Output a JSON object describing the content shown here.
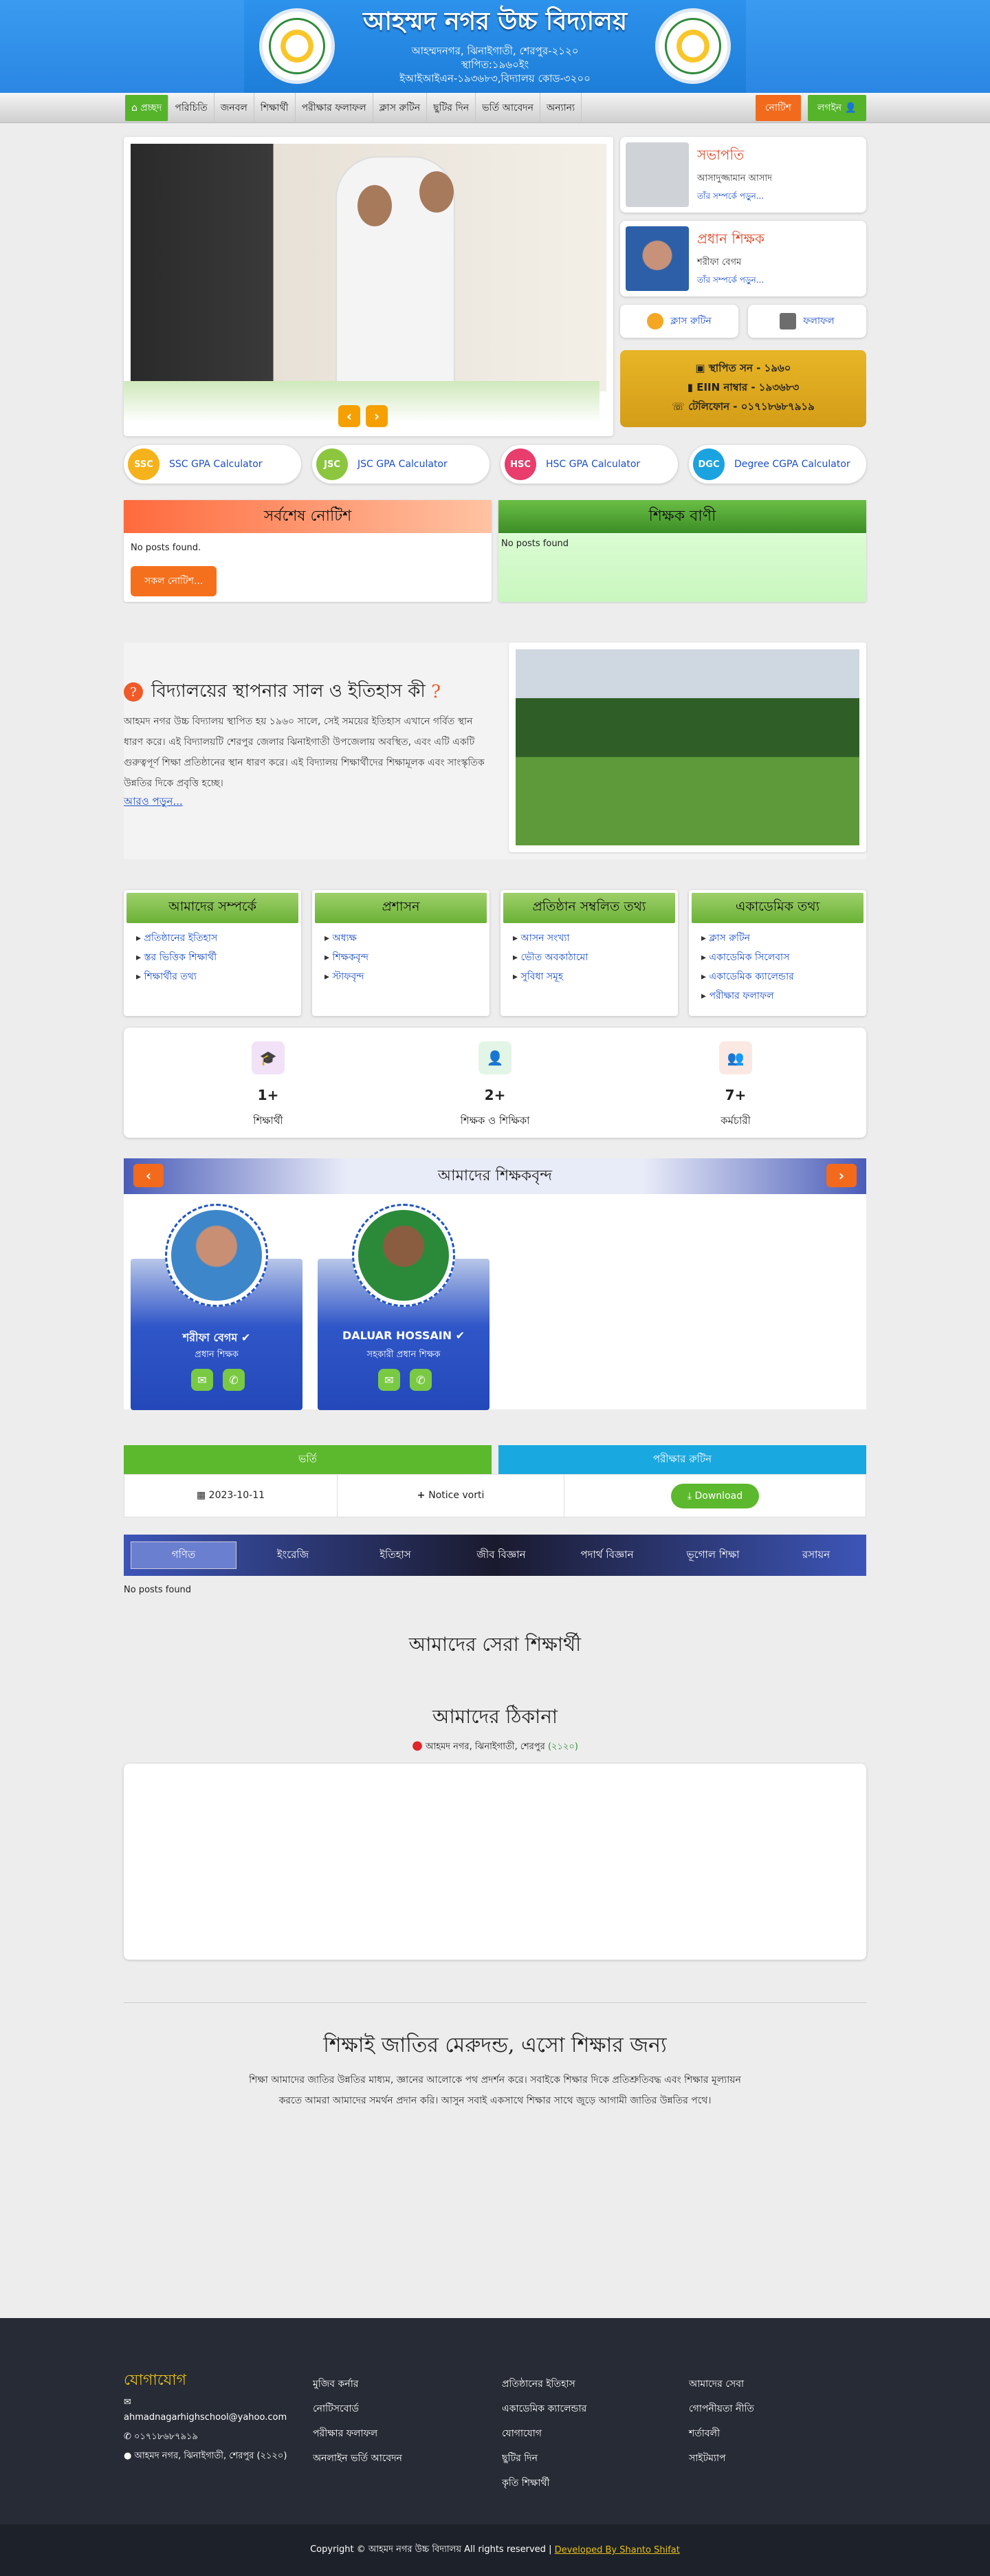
{
  "header": {
    "title": "আহম্মদ নগর উচ্চ বিদ্যালয়",
    "lines": [
      "আহম্মদনগর, ঝিনাইগাতী, শেরপুর-২১২০",
      "স্থাপিত:১৯৬০ইং",
      "ইআইআইএন-১৯৩৬৮৩,বিদ্যালয় কোড-৩২০০"
    ]
  },
  "nav": {
    "home": "প্রচ্ছদ",
    "items": [
      "পরিচিতি",
      "জনবল",
      "শিক্ষার্থী",
      "পরীক্ষার ফলাফল",
      "ক্লাস রুটিন",
      "ছুটির দিন",
      "ভর্তি আবেদন",
      "অন্যান্য"
    ],
    "notice": "নোটিশ",
    "login": "লগইন"
  },
  "profiles": [
    {
      "title": "সভাপতি",
      "name": "আসাদুজ্জামান আসাদ",
      "more": "তাঁর সম্পর্কে পড়ুন..."
    },
    {
      "title": "প্রধান শিক্ষক",
      "name": "শরীফা বেগম",
      "more": "তাঁর সম্পর্কে পড়ুন..."
    }
  ],
  "quick": {
    "routine": "ক্লাস রুটিন",
    "result": "ফলাফল"
  },
  "info": {
    "established": "স্থাপিত সন - ১৯৬০",
    "eiin": "EIIN নাম্বার - ১৯৩৬৮৩",
    "phone": "টেলিফোন - ০১৭১৮৬৮৭৯১৯"
  },
  "gpa": [
    {
      "badge": "SSC",
      "label": "SSC GPA Calculator",
      "color": "#f5b21b"
    },
    {
      "badge": "JSC",
      "label": "JSC GPA Calculator",
      "color": "#8cc63f"
    },
    {
      "badge": "HSC",
      "label": "HSC GPA Calculator",
      "color": "#e83d6d"
    },
    {
      "badge": "DGC",
      "label": "Degree CGPA Calculator",
      "color": "#1ba3e0"
    }
  ],
  "notice": {
    "title": "সর্বশেষ নোটিশ",
    "empty": "No posts found.",
    "all": "সকল নোটিশ...",
    "speech": "শিক্ষক বাণী",
    "speech_empty": "No posts found"
  },
  "history": {
    "title": "বিদ্যালয়ের স্থাপনার সাল ও ইতিহাস কী",
    "text": "আহমদ নগর উচ্চ বিদ্যালয় স্থাপিত হয় ১৯৬০ সালে, সেই সময়ের ইতিহাস এখানে গর্বিত স্থান ধারণ করে। এই বিদ্যালয়টি শেরপুর জেলার ঝিনাইগাতী উপজেলায় অবস্থিত, এবং এটি একটি গুরুত্বপূর্ণ শিক্ষা প্রতিষ্ঠানের স্থান ধারণ করে। এই বিদ্যালয় শিক্ষার্থীদের শিক্ষামূলক এবং সাংস্কৃতিক উন্নতির দিকে প্রবৃত্তি হচ্ছে।",
    "more": "আরও পড়ুন..."
  },
  "categories": [
    {
      "title": "আমাদের সম্পর্কে",
      "links": [
        "প্রতিষ্ঠানের ইতিহাস",
        "স্তর ভিত্তিক শিক্ষার্থী",
        "শিক্ষার্থীর তথ্য"
      ]
    },
    {
      "title": "প্রশাসন",
      "links": [
        "অধ্যক্ষ",
        "শিক্ষকবৃন্দ",
        "স্টাফবৃন্দ"
      ]
    },
    {
      "title": "প্রতিষ্ঠান সম্বলিত তথ্য",
      "links": [
        "আসন সংখ্যা",
        "ভৌত অবকাঠামো",
        "সুবিধা সমূহ"
      ]
    },
    {
      "title": "একাডেমিক তথ্য",
      "links": [
        "ক্লাস রুটিন",
        "একাডেমিক সিলেবাস",
        "একাডেমিক ক্যালেন্ডার",
        "পরীক্ষার ফলাফল"
      ]
    }
  ],
  "stats": [
    {
      "value": "1+",
      "label": "শিক্ষার্থী",
      "color": "#f1e2f7",
      "icon": "🎓"
    },
    {
      "value": "2+",
      "label": "শিক্ষক ও শিক্ষিকা",
      "color": "#e2f5e6",
      "icon": "👤"
    },
    {
      "value": "7+",
      "label": "কর্মচারী",
      "color": "#fbe8e2",
      "icon": "👥"
    }
  ],
  "teachers": {
    "title": "আমাদের শিক্ষকবৃন্দ",
    "list": [
      {
        "name": "শরীফা বেগম",
        "role": "প্রধান শিক্ষক"
      },
      {
        "name": "DALUAR HOSSAIN",
        "role": "সহকারী প্রধান শিক্ষক"
      }
    ]
  },
  "admission": {
    "h1": "ভর্তি",
    "h2": "পরীক্ষার রুটিন",
    "date": "2023-10-11",
    "notice": "Notice vorti",
    "download": "Download"
  },
  "subjects": [
    "গণিত",
    "ইংরেজি",
    "ইতিহাস",
    "জীব বিজ্ঞান",
    "পদার্থ বিজ্ঞান",
    "ভূগোল শিক্ষা",
    "রসায়ন"
  ],
  "subjects_empty": "No posts found",
  "best": "আমাদের সেরা শিক্ষার্থী",
  "address": {
    "title": "আমাদের ঠিকানা",
    "text": "আহমদ নগর, ঝিনাইগাতী, শেরপুর",
    "code": "(২১২০)"
  },
  "slogan": {
    "title": "শিক্ষাই জাতির মেরুদন্ড, এসো শিক্ষার জন্য",
    "text": "শিক্ষা আমাদের জাতির উন্নতির মাধ্যম, জ্ঞানের আলোকে পথ প্রদর্শন করে। সবাইকে শিক্ষার দিকে প্রতিশ্রুতিবদ্ধ এবং শিক্ষার মূল্যায়ন করতে আমরা আমাদের সমর্থন প্রদান করি। আসুন সবাই একসাথে শিক্ষার সাথে জুড়ে আগামী জাতির উন্নতির পথে।"
  },
  "footer": {
    "contact": "যোগাযোগ",
    "email": "ahmadnagarhighschool@yahoo.com",
    "phone": "০১৭১৮৬৮৭৯১৯",
    "addr": "আহমদ নগর, ঝিনাইগাতী, শেরপুর (২১২০)",
    "c2": [
      "মুজিব কর্নার",
      "নোটিসবোর্ড",
      "পরীক্ষার ফলাফল",
      "অনলাইন ভর্তি আবেদন"
    ],
    "c3": [
      "প্রতিষ্ঠানের ইতিহাস",
      "একাডেমিক ক্যালেন্ডার",
      "যোগাযোগ",
      "ছুটির দিন",
      "কৃতি শিক্ষার্থী"
    ],
    "c4": [
      "আমাদের সেবা",
      "গোপনীয়তা নীতি",
      "শর্তাবলী",
      "সাইটম্যাপ"
    ],
    "copy": "Copyright © আহমদ নগর উচ্চ বিদ্যালয় All rights reserved |",
    "dev": "Developed By Shanto Shifat"
  }
}
